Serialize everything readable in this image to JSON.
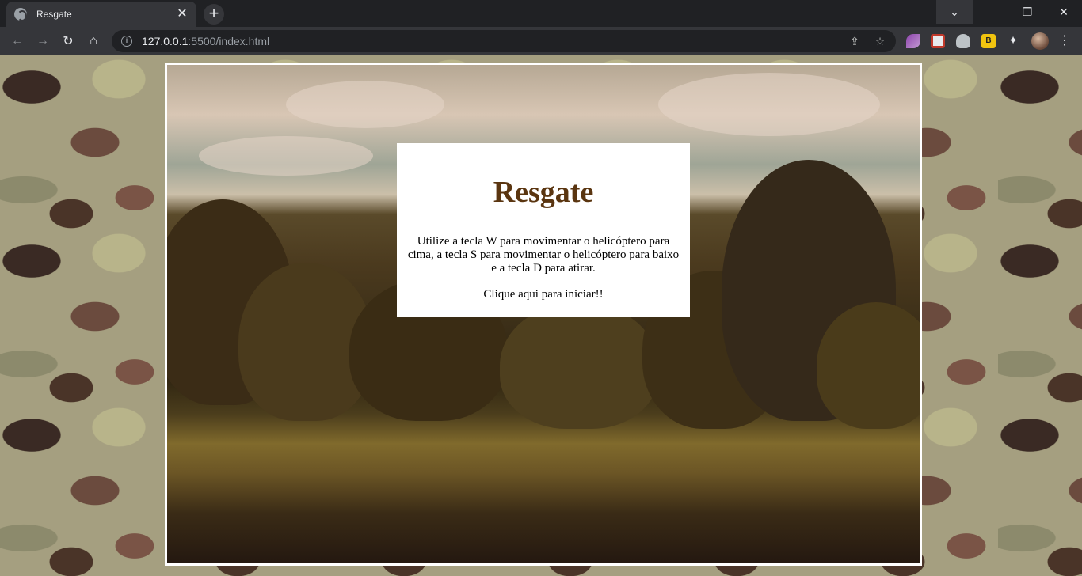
{
  "browser": {
    "tab_title": "Resgate",
    "tab_close": "✕",
    "new_tab": "+",
    "url_host": "127.0.0.1",
    "url_rest": ":5500/index.html",
    "window_controls": {
      "tab_search": "⌄",
      "minimize": "—",
      "maximize": "❐",
      "close": "✕"
    },
    "nav": {
      "back": "←",
      "forward": "→",
      "reload": "↻",
      "home": "⌂"
    },
    "omnibox_icons": {
      "info": "i",
      "share": "⇪",
      "star": "☆"
    },
    "extensions": {
      "bookmark_badge": "B",
      "puzzle": "✦"
    },
    "menu": "⋮"
  },
  "game": {
    "title": "Resgate",
    "instructions": "Utilize a tecla W para movimentar o helicóptero para cima, a tecla S para movimentar o helicóptero para baixo e a tecla D para atirar.",
    "start_link": "Clique aqui para iniciar!!"
  },
  "colors": {
    "title": "#5a3510",
    "frame_border": "#ffffff",
    "chrome_dark": "#202124",
    "chrome_toolbar": "#35363a"
  }
}
